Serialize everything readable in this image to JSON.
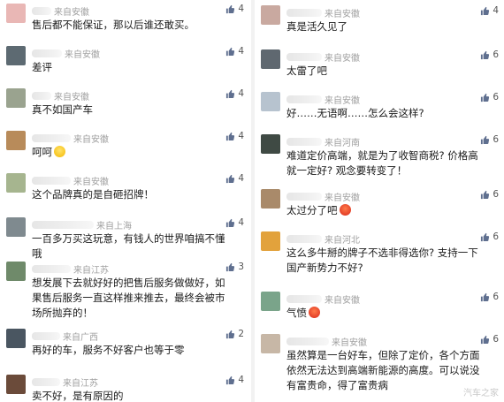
{
  "left": [
    {
      "meta": "来自安徽",
      "text": "售后都不能保证，那以后谁还敢买。",
      "likes": "4",
      "avatar_color": "#e9b7b5",
      "name_width": 22
    },
    {
      "meta": "来自安徽",
      "text": "差评",
      "likes": "4",
      "avatar_color": "#5d6a72",
      "name_width": 34
    },
    {
      "meta": "来自安徽",
      "text": "真不如国产车",
      "likes": "4",
      "avatar_color": "#9aa38f",
      "name_width": 22
    },
    {
      "meta": "来自安徽",
      "text": "呵呵",
      "likes": "4",
      "avatar_color": "#b88b5a",
      "name_width": 44,
      "emoji": "smile"
    },
    {
      "meta": "来自安徽",
      "text": "这个品牌真的是自砸招牌！",
      "likes": "4",
      "avatar_color": "#a6b58f",
      "name_width": 44
    },
    {
      "meta": "来自上海",
      "text": "一百多万买这玩意，有钱人的世界咱搞不懂哦",
      "likes": "4",
      "avatar_color": "#7f8a8f",
      "name_width": 70
    },
    {
      "meta": "来自江苏",
      "text": "想发展下去就好好的把售后服务做做好，如果售后服务一直这样推来推去，最终会被市场所抛弃的！",
      "likes": "3",
      "avatar_color": "#6f8a6a",
      "name_width": 44
    },
    {
      "meta": "来自广西",
      "text": "再好的车，服务不好客户也等于零",
      "likes": "2",
      "avatar_color": "#4a5661",
      "name_width": 32
    },
    {
      "meta": "来自江苏",
      "text": "卖不好，是有原因的",
      "likes": "4",
      "avatar_color": "#6b4b3a",
      "name_width": 32
    }
  ],
  "right": [
    {
      "meta": "来自安徽",
      "text": "真是活久见了",
      "likes": "4",
      "avatar_color": "#c9a9a0",
      "name_width": 40
    },
    {
      "meta": "来自安徽",
      "text": "太雷了吧",
      "likes": "6",
      "avatar_color": "#5f6870",
      "name_width": 40
    },
    {
      "meta": "来自安徽",
      "text": "好……无语啊……怎么会这样?",
      "likes": "6",
      "avatar_color": "#b7c3cf",
      "name_width": 40
    },
    {
      "meta": "来自河南",
      "text": "难道定价高端，就是为了收智商税? 价格高就一定好? 观念要转变了！",
      "likes": "6",
      "avatar_color": "#3f4a44",
      "name_width": 40
    },
    {
      "meta": "来自安徽",
      "text": "太过分了吧",
      "likes": "6",
      "avatar_color": "#a98a6a",
      "name_width": 40,
      "emoji": "angry"
    },
    {
      "meta": "来自河北",
      "text": "这么多牛掰的牌子不选非得选你? 支持一下国产新势力不好?",
      "likes": "6",
      "avatar_color": "#e2a23c",
      "name_width": 40
    },
    {
      "meta": "来自安徽",
      "text": "气愤",
      "likes": "6",
      "avatar_color": "#7aa48a",
      "name_width": 40,
      "emoji": "angry"
    },
    {
      "meta": "来自安徽",
      "text": "虽然算是一台好车，但除了定价，各个方面依然无法达到高端新能源的高度。可以说没有富贵命，得了富贵病",
      "likes": "6",
      "avatar_color": "#c7b7a6",
      "name_width": 48
    }
  ],
  "watermark": "汽车之家",
  "accent": "#6c7fa0"
}
